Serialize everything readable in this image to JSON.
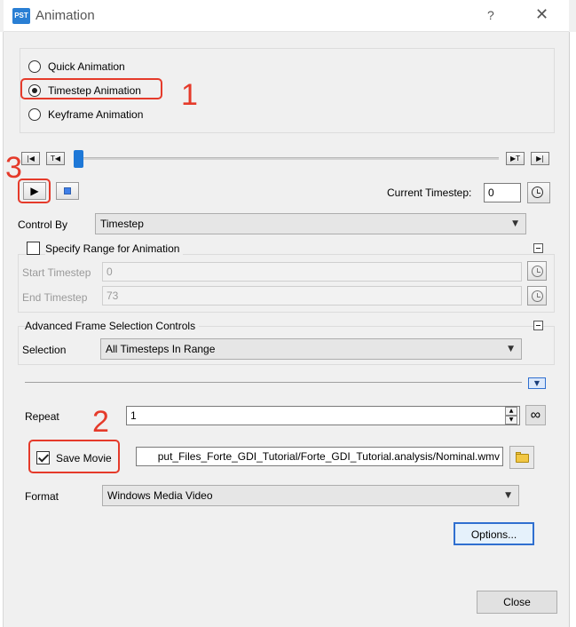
{
  "window": {
    "app_icon_text": "PST",
    "title": "Animation",
    "help": "?",
    "close": "✕"
  },
  "mode": {
    "options": [
      "Quick Animation",
      "Timestep Animation",
      "Keyframe Animation"
    ],
    "selected": "Timestep Animation"
  },
  "timeline": {
    "first_glyph": "|◀",
    "prev_glyph": "T◀",
    "next_glyph": "▶T",
    "last_glyph": "▶|",
    "play_glyph": "▶",
    "position": 0.0
  },
  "current_timestep": {
    "label": "Current Timestep:",
    "value": "0"
  },
  "control_by": {
    "label": "Control By",
    "value": "Timestep"
  },
  "range": {
    "title": "Specify Range for Animation",
    "checked": false,
    "start_label": "Start Timestep",
    "start_value": "0",
    "end_label": "End Timestep",
    "end_value": "73"
  },
  "advanced": {
    "title": "Advanced Frame Selection Controls",
    "selection_label": "Selection",
    "selection_value": "All Timesteps In Range"
  },
  "repeat": {
    "label": "Repeat",
    "value": "1",
    "infinity": "∞"
  },
  "save_movie": {
    "label": "Save Movie",
    "checked": true,
    "path": "put_Files_Forte_GDI_Tutorial/Forte_GDI_Tutorial.analysis/Nominal.wmv"
  },
  "format": {
    "label": "Format",
    "value": "Windows Media Video"
  },
  "buttons": {
    "options": "Options...",
    "close": "Close"
  },
  "annotations": {
    "one": "1",
    "two": "2",
    "three": "3"
  },
  "colors": {
    "annotation": "#e53a2a",
    "slider": "#1e78d7",
    "options_border": "#2f6fd0"
  }
}
